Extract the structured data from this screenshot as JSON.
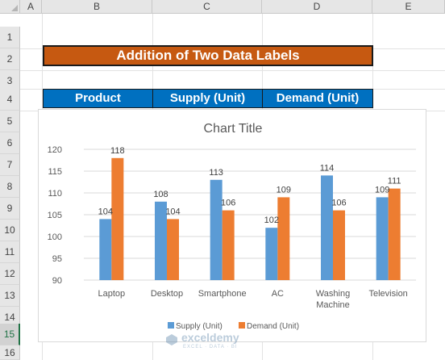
{
  "columns": [
    "A",
    "B",
    "C",
    "D",
    "E"
  ],
  "rows": [
    "1",
    "2",
    "3",
    "4",
    "5",
    "6",
    "7",
    "8",
    "9",
    "10",
    "11",
    "12",
    "13",
    "14",
    "15",
    "16"
  ],
  "selected_row": "15",
  "sheet": {
    "title": "Addition of Two Data Labels",
    "headers": [
      "Product",
      "Supply (Unit)",
      "Demand (Unit)"
    ]
  },
  "colors": {
    "title_fill": "#c65911",
    "header_fill": "#0070c0",
    "supply": "#5b9bd5",
    "demand": "#ed7d31"
  },
  "chart_data": {
    "type": "bar",
    "title": "Chart Title",
    "categories": [
      "Laptop",
      "Desktop",
      "Smartphone",
      "AC",
      "Washing Machine",
      "Television"
    ],
    "category_lines": [
      [
        "Laptop"
      ],
      [
        "Desktop"
      ],
      [
        "Smartphone"
      ],
      [
        "AC"
      ],
      [
        "Washing",
        "Machine"
      ],
      [
        "Television"
      ]
    ],
    "series": [
      {
        "name": "Supply (Unit)",
        "values": [
          104,
          108,
          113,
          102,
          114,
          109
        ]
      },
      {
        "name": "Demand (Unit)",
        "values": [
          118,
          104,
          106,
          109,
          106,
          111
        ]
      }
    ],
    "ylim": [
      90,
      120
    ],
    "yticks": [
      90,
      95,
      100,
      105,
      110,
      115,
      120
    ],
    "grid": true,
    "legend": "bottom"
  },
  "watermark": {
    "name": "exceldemy",
    "tagline": "EXCEL · DATA · BI"
  }
}
